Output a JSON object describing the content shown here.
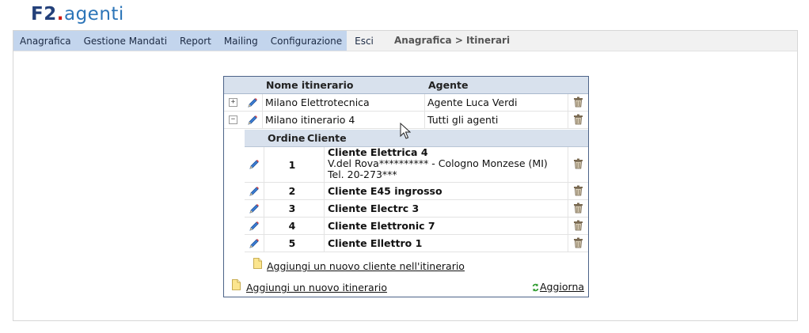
{
  "app": {
    "logo_prefix": "F2",
    "logo_dot": ".",
    "logo_suffix": "agenti"
  },
  "menu": {
    "items": [
      {
        "label": "Anagrafica",
        "name": "menu-anagrafica"
      },
      {
        "label": "Gestione Mandati",
        "name": "menu-gestione-mandati"
      },
      {
        "label": "Report",
        "name": "menu-report"
      },
      {
        "label": "Mailing",
        "name": "menu-mailing"
      },
      {
        "label": "Configurazione",
        "name": "menu-configurazione"
      },
      {
        "label": "Esci",
        "name": "menu-esci"
      }
    ],
    "breadcrumb": "Anagrafica > Itinerari"
  },
  "table": {
    "headers": {
      "name": "Nome itinerario",
      "agent": "Agente"
    },
    "itineraries": [
      {
        "expander": "+",
        "name": "Milano Elettrotecnica",
        "agent": "Agente Luca Verdi"
      },
      {
        "expander": "−",
        "name": "Milano itinerario 4",
        "agent": "Tutti gli agenti"
      }
    ],
    "sub_headers": {
      "order": "Ordine",
      "client": "Cliente"
    },
    "clients": [
      {
        "order": "1",
        "name": "Cliente Elettrica 4",
        "address": "V.del Rova********** - Cologno Monzese (MI)",
        "phone": "Tel. 20-273***"
      },
      {
        "order": "2",
        "name": "Cliente E45 ingrosso"
      },
      {
        "order": "3",
        "name": "Cliente Electrc 3"
      },
      {
        "order": "4",
        "name": "Cliente Elettronic 7"
      },
      {
        "order": "5",
        "name": "Cliente Ellettro 1"
      }
    ],
    "add_client_link": "Aggiungi un nuovo cliente nell'itinerario",
    "add_itinerary_link": "Aggiungi un nuovo itinerario",
    "refresh_link": "Aggiorna"
  },
  "colors": {
    "menu_bg": "#c3d5ed",
    "header_bg": "#d8e1ed",
    "panel_border": "#4c6388",
    "logo_blue": "#23407a",
    "logo_red": "#d11a14"
  }
}
